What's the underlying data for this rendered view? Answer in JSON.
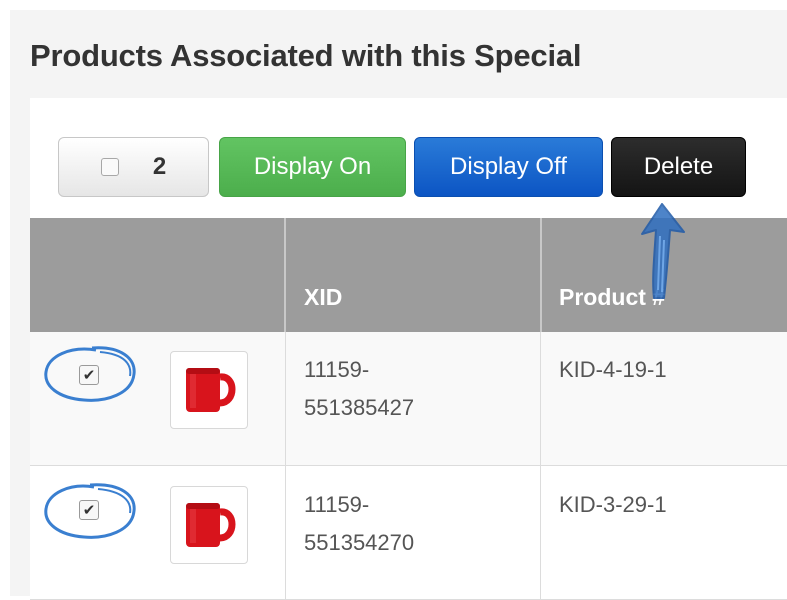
{
  "title": "Products Associated with this Special",
  "toolbar": {
    "select_count": "2",
    "display_on_label": "Display On",
    "display_off_label": "Display Off",
    "delete_label": "Delete"
  },
  "table": {
    "columns": [
      "",
      "XID",
      "Product #"
    ],
    "rows": [
      {
        "checked": true,
        "xid_line1": "11159-",
        "xid_line2": "551385427",
        "product": "KID-4-19-1",
        "checkmark": "✔"
      },
      {
        "checked": true,
        "xid_line1": "11159-",
        "xid_line2": "551354270",
        "product": "KID-3-29-1",
        "checkmark": "✔"
      }
    ]
  },
  "colors": {
    "display_on": "#5cb85c",
    "display_off": "#0d5bd0",
    "delete": "#222222",
    "header_bg": "#9c9c9c",
    "annotation": "#3a7fd0",
    "mug": "#d8141c"
  },
  "icons": [
    "checkbox-icon",
    "mug-icon",
    "annotation-arrow-icon",
    "annotation-circle-icon"
  ]
}
